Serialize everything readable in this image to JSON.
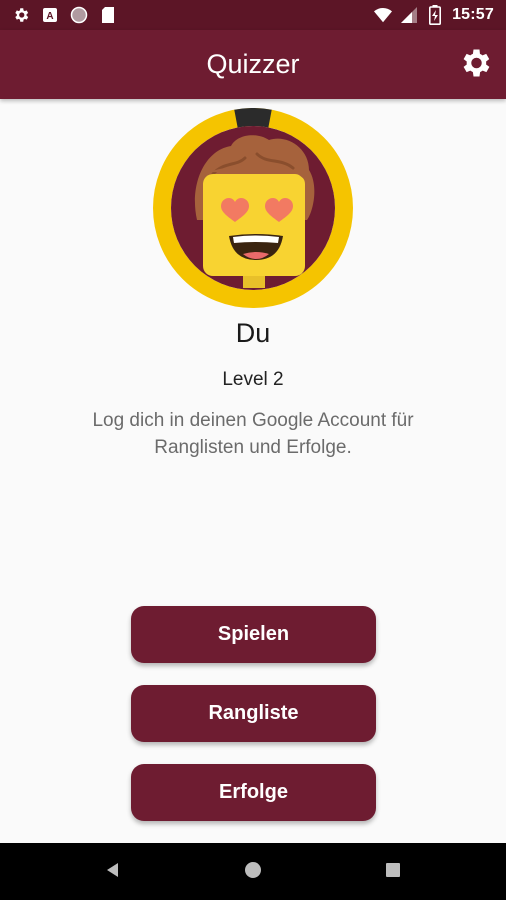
{
  "status_bar": {
    "time": "15:57",
    "icons": [
      "settings-gear-icon",
      "translate-icon",
      "circle-notification-icon",
      "sd-card-icon",
      "wifi-icon",
      "signal-icon",
      "battery-charging-icon"
    ]
  },
  "app_bar": {
    "title": "Quizzer",
    "settings_icon": "gear-icon"
  },
  "profile": {
    "name": "Du",
    "level": "Level 2",
    "level_progress": 0.03,
    "login_hint": "Log dich in deinen Google Account für Ranglisten und Erfolge."
  },
  "menu": {
    "play_label": "Spielen",
    "ranking_label": "Rangliste",
    "achievements_label": "Erfolge"
  },
  "nav": {
    "icons": [
      "back-icon",
      "home-icon",
      "recents-icon"
    ]
  },
  "colors": {
    "primary": "#6e1c31",
    "primary_dark": "#5c1526",
    "ring": "#f5c400",
    "face": "#f8d331",
    "hair": "#a6623c"
  }
}
